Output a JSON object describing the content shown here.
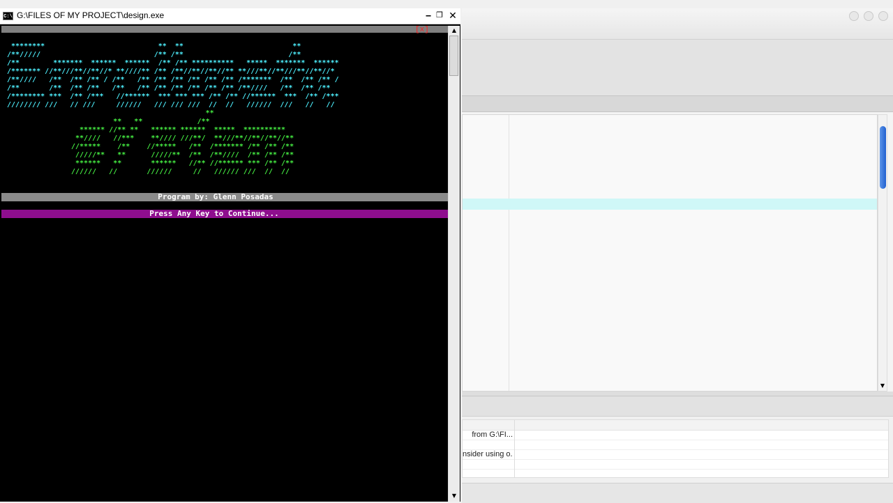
{
  "console": {
    "title": "G:\\FILES OF MY PROJECT\\design.exe",
    "icon_label": "C:\\",
    "controls": {
      "minimize": "‒",
      "maximize": "❐",
      "close": "✕"
    },
    "close_marker": "[x]",
    "ascii_cyan": " ********                           **  **                          **\n/**/////                           /** /**                         /**\n/**        *******  ******  ******  /** /** **********   *****  *******  ******\n/******* //**///**//**//* **////** /** /**//**//**//** **///**//**///**//**//*\n/**////   /**  /** /** / /**   /** /** /** /** /** /** /*******  /**  /** /** /\n/**       /**  /** /**   /**   /** /** /** /** /** /** /**////   /**  /** /**\n/******** ***  /** /***   //******  *** *** *** /** /** //******  ***  /** /***\n//////// ///   // ///     //////   /// /// ///  //  //   //////  ///   //   //",
    "ascii_green": "                                **\n          **   **             /**\n  ****** //** **   ****** ******  *****  **********\n **////   //***    **//// ///**/  **///**//**//**//**\n//*****    /**    //*****   /**  /******* /** /** /**\n /////**   **      /////**  /**  /**////  /** /** /**\n ******   **       ******   //** //****** *** /** /**\n//////   //       //////     //   ////// ///  //  //",
    "credit": "Program by: Glenn Posadas",
    "prompt": "Press Any Key to Continue...",
    "scroll": {
      "up": "▲",
      "down": "▼"
    }
  },
  "ide": {
    "editor_scroll_down": "▼",
    "messages": [
      {
        "text": "from G:\\FI..."
      },
      {
        "text": "nsider using o..."
      }
    ]
  },
  "colors": {
    "ascii_cyan": "#4ef1ff",
    "ascii_green": "#46f043",
    "prompt_bar": "#8e0e8e",
    "credit_bar": "#8a8a8a",
    "close_marker": "#ff2020",
    "current_line": "#cff7f7",
    "scroll_thumb": "#2f6fd8"
  }
}
